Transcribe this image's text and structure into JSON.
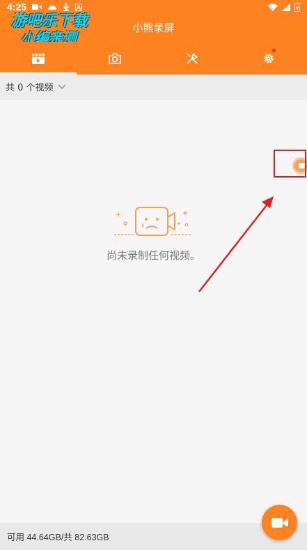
{
  "status_bar": {
    "time": "4:25"
  },
  "app": {
    "title": "小熊录屏"
  },
  "watermark": {
    "line1": "游吧乐下载",
    "line2": "小编亲测"
  },
  "tabs": [
    {
      "icon": "video-clip-icon",
      "active": true
    },
    {
      "icon": "camera-icon",
      "active": false
    },
    {
      "icon": "tools-icon",
      "active": false
    },
    {
      "icon": "gear-icon",
      "active": false,
      "badge": true
    }
  ],
  "filter": {
    "label": "共 0 个视频"
  },
  "empty_state": {
    "message": "尚未录制任何视频。"
  },
  "storage": {
    "text": "可用 44.64GB/共 82.63GB"
  },
  "colors": {
    "accent": "#ff8220",
    "annotation": "#e02020"
  }
}
